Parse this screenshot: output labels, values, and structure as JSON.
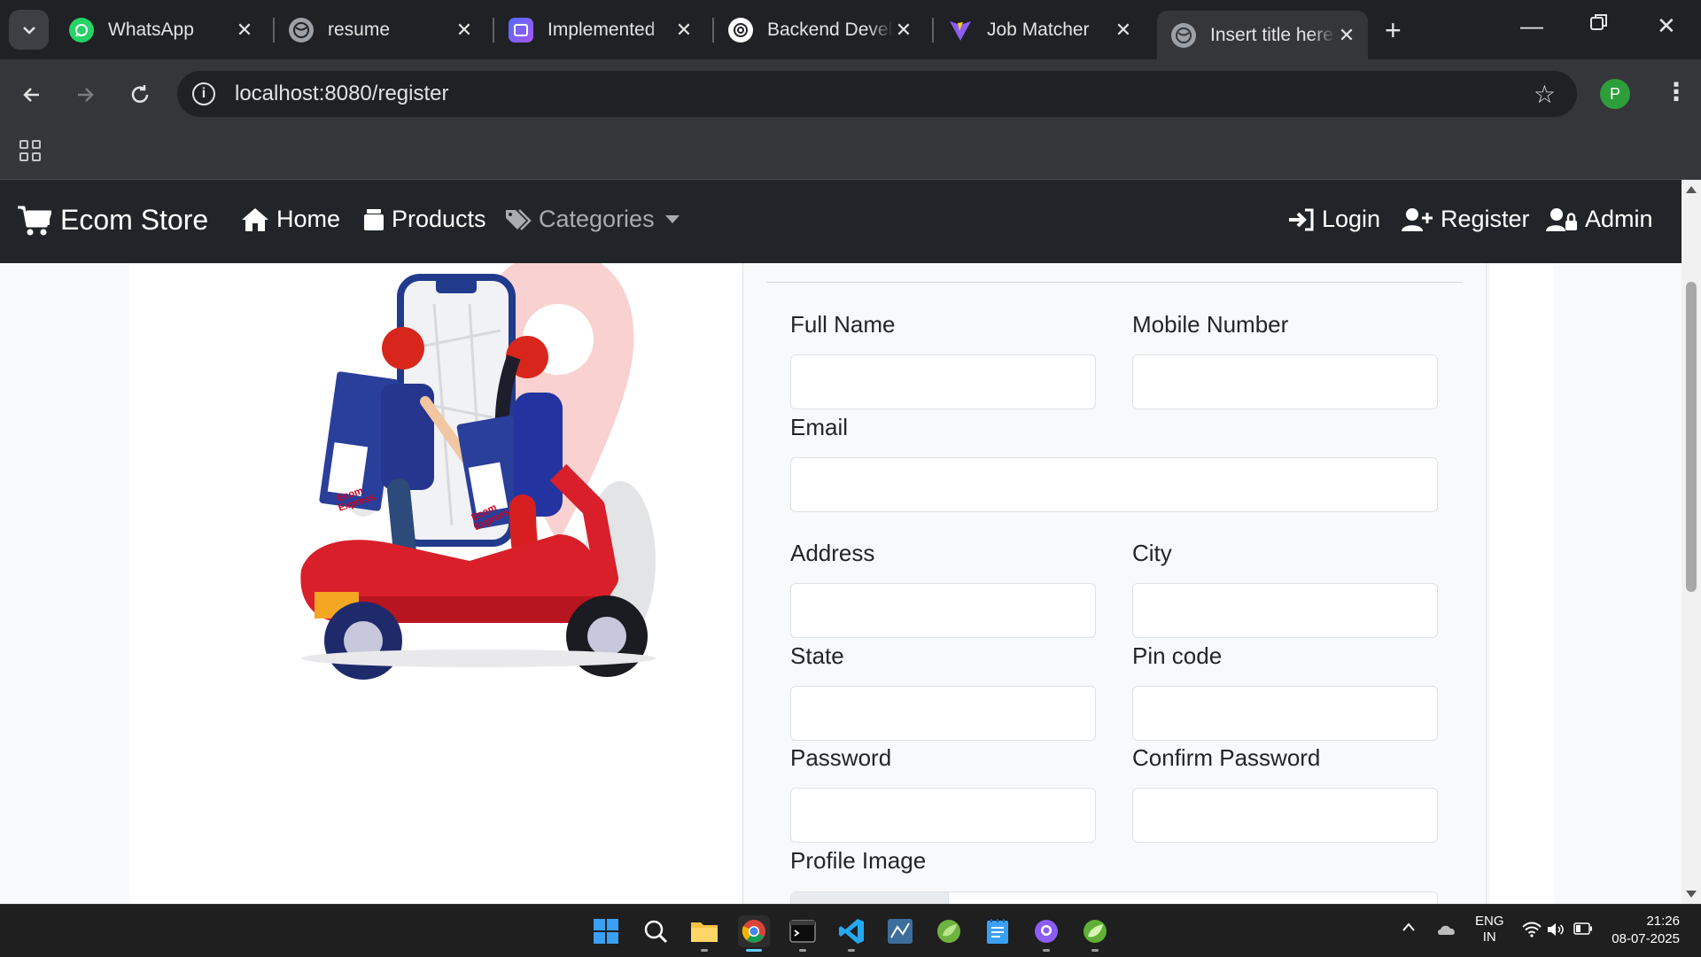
{
  "browser": {
    "tabs": [
      {
        "title": "WhatsApp",
        "icon": "whatsapp-icon"
      },
      {
        "title": "resume",
        "icon": "globe-icon"
      },
      {
        "title": "Implemented",
        "icon": "app-icon"
      },
      {
        "title": "Backend Devel",
        "icon": "openai-icon"
      },
      {
        "title": "Job Matcher",
        "icon": "vite-icon"
      },
      {
        "title": "Insert title here",
        "icon": "globe-icon",
        "active": true
      }
    ],
    "url": "localhost:8080/register",
    "profile_initial": "P"
  },
  "site": {
    "brand": "Ecom Store",
    "nav": {
      "home": "Home",
      "products": "Products",
      "categories": "Categories",
      "login": "Login",
      "register": "Register",
      "admin": "Admin"
    }
  },
  "illustration_text": {
    "box_label": "Ecom Express"
  },
  "form": {
    "full_name": "Full Name",
    "mobile_number": "Mobile Number",
    "email": "Email",
    "address": "Address",
    "city": "City",
    "state": "State",
    "pin_code": "Pin code",
    "password": "Password",
    "confirm_password": "Confirm Password",
    "profile_image": "Profile Image"
  },
  "taskbar": {
    "lang_line1": "ENG",
    "lang_line2": "IN",
    "time": "21:26",
    "date": "08-07-2025"
  },
  "colors": {
    "navbar": "#212529",
    "page_bg": "#f8f9fa",
    "browser_dark": "#202124",
    "browser_toolbar": "#35363a"
  }
}
